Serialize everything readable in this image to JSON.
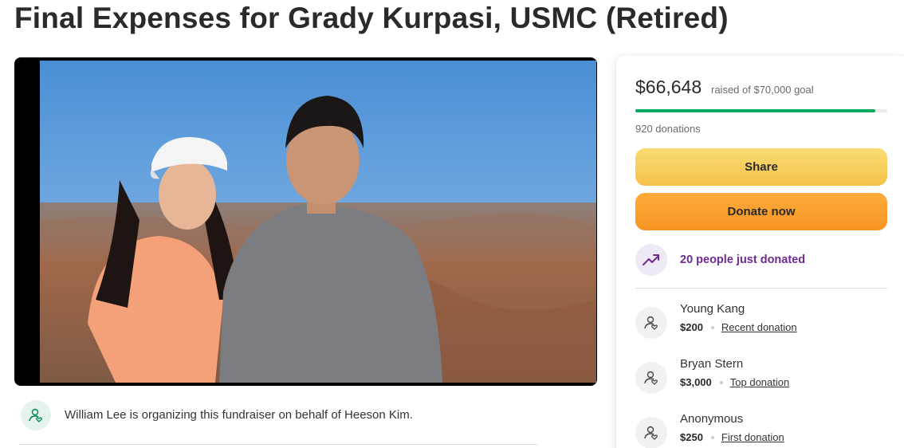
{
  "page": {
    "title": "Final Expenses for Grady Kurpasi, USMC (Retired)"
  },
  "media": {
    "photo_icon": "family-photo-grand-canyon",
    "colors": {
      "sky": "#4a8fd6",
      "canyon": "#a0684a"
    }
  },
  "organizer": {
    "icon": "heart-person-icon",
    "text": "William Lee is organizing this fundraiser on behalf of Heeson Kim."
  },
  "donation_card": {
    "raised": "$66,648",
    "goal_text": "raised of $70,000 goal",
    "progress_fraction": 0.952,
    "donations_count": "920 donations",
    "share_label": "Share",
    "donate_label": "Donate now",
    "trending_text": "20 people just donated",
    "colors": {
      "progress": "#02a95c",
      "share_button": "#f7cf5c",
      "donate_button": "#f9a22e",
      "trending_text": "#6d2a8f"
    },
    "donors": [
      {
        "name": "Young Kang",
        "amount": "$200",
        "tag": "Recent donation"
      },
      {
        "name": "Bryan Stern",
        "amount": "$3,000",
        "tag": "Top donation"
      },
      {
        "name": "Anonymous",
        "amount": "$250",
        "tag": "First donation"
      }
    ]
  }
}
